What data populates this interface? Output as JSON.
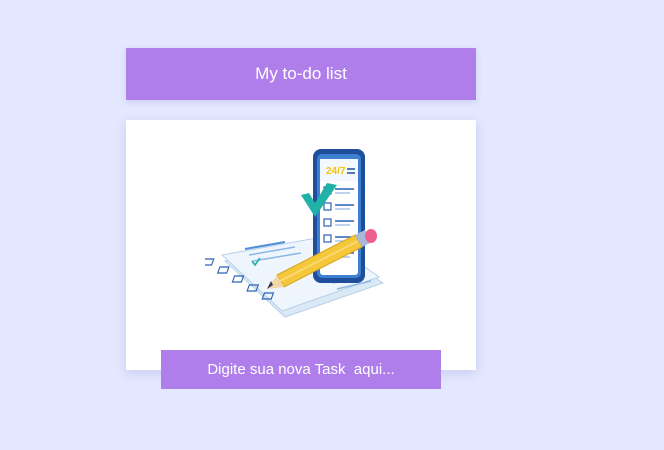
{
  "header": {
    "title": "My to-do list"
  },
  "card": {
    "illustration": "todo-checklist-phone-illustration",
    "phone_badge": "24/7"
  },
  "task_input": {
    "label": "Digite sua nova Task  aqui..."
  },
  "colors": {
    "background": "#e3e7ff",
    "accent": "#af7eeb",
    "card": "#ffffff",
    "check": "#20b2a8",
    "phone": "#2c63b3",
    "pencil": "#f5c73a",
    "eraser": "#ee5f8f"
  }
}
